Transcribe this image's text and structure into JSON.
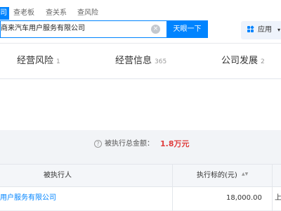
{
  "search_tabs": [
    "司",
    "查老板",
    "查关系",
    "查风险"
  ],
  "search": {
    "query": "商来汽车用户服务有限公司",
    "button_label": "天眼一下",
    "clear_symbol": "×"
  },
  "apps": {
    "label": "应用",
    "chevron": "▾"
  },
  "categories": [
    {
      "label": "经营风险",
      "count": "1"
    },
    {
      "label": "经营信息",
      "count": "365"
    },
    {
      "label": "公司发展",
      "count": "2"
    }
  ],
  "summary": {
    "label": "被执行总金额：",
    "value": "1.8万元",
    "info_symbol": "?"
  },
  "table": {
    "headers": [
      "被执行人",
      "执行标的(元)"
    ],
    "sort_symbol": "▲▼",
    "rows": [
      {
        "name": "用户服务有限公司",
        "amount": "18,000.00",
        "extra": "上"
      }
    ]
  },
  "colors": {
    "accent": "#0084ff",
    "amount_red": "#e03e3e"
  }
}
